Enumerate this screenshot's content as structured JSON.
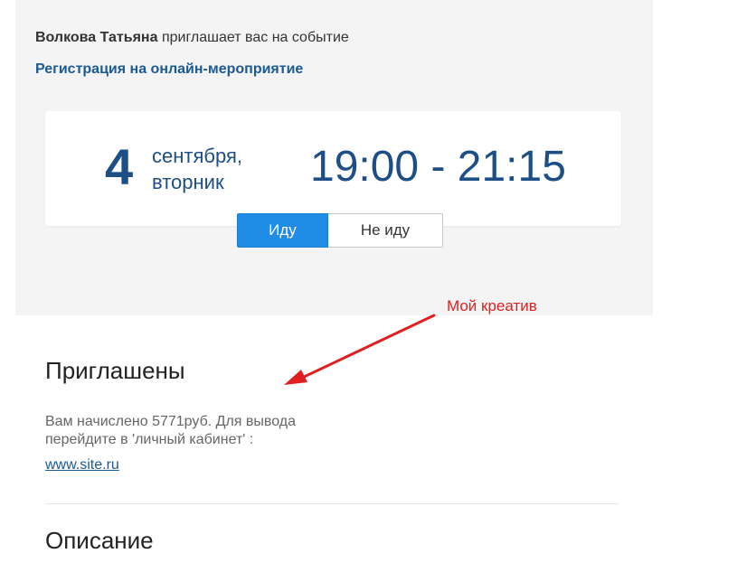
{
  "invitation": {
    "host_name": "Волкова Татьяна",
    "invite_text": "приглашает вас на событие",
    "event_title": "Регистрация на онлайн-мероприятие"
  },
  "event_date": {
    "day": "4",
    "month": "сентября,",
    "weekday": "вторник",
    "time_range": "19:00 - 21:15"
  },
  "rsvp": {
    "going_label": "Иду",
    "not_going_label": "Не иду",
    "selected": "going"
  },
  "annotation": {
    "label": "Мой креатив",
    "color": "#e02020"
  },
  "invited_section": {
    "title": "Приглашены",
    "message": "Вам начислено 5771руб. Для вывода перейдите в 'личный кабинет' :",
    "link_text": "www.site.ru"
  },
  "description_section": {
    "title": "Описание"
  },
  "colors": {
    "accent": "#1f8ce6",
    "date_text": "#1d4f86",
    "link": "#1a5a96",
    "panel_bg": "#f4f4f4"
  }
}
